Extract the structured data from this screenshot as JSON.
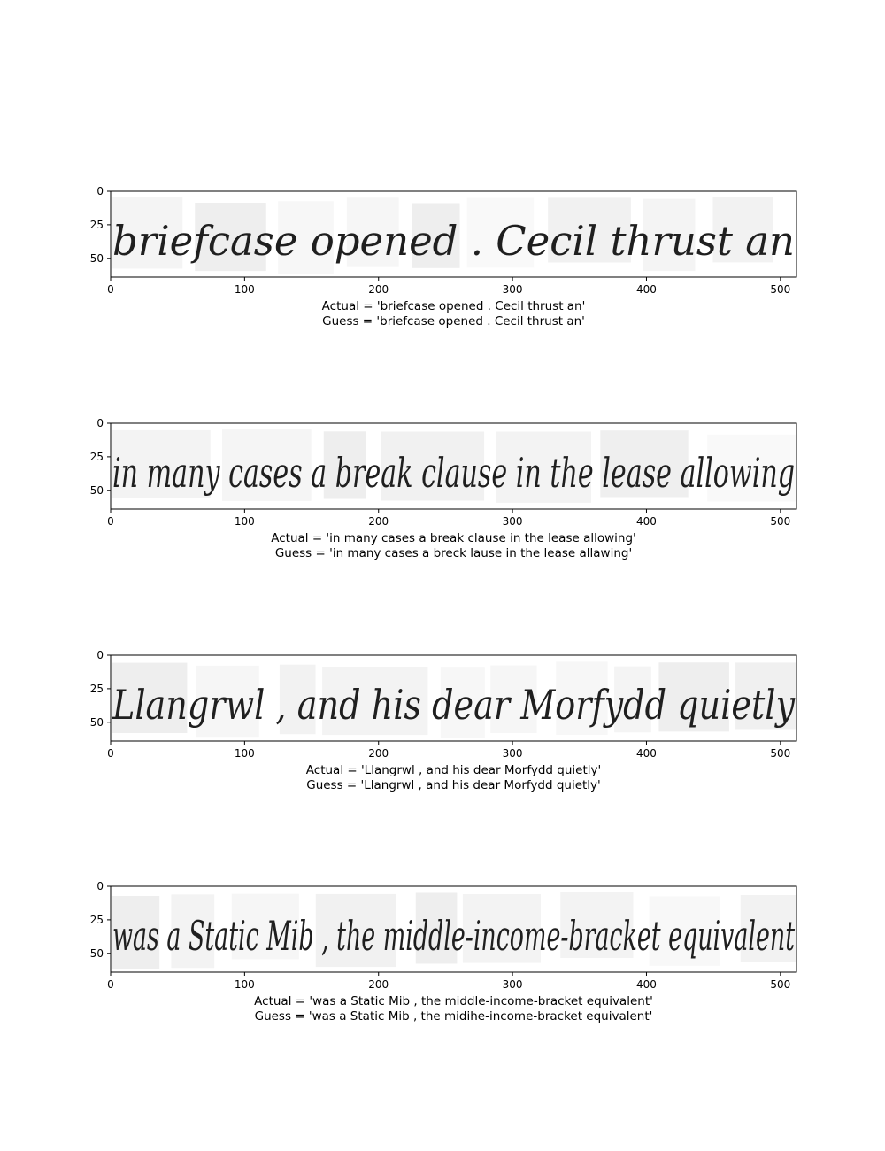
{
  "figure": {
    "panels": [
      {
        "handwriting": "briefcase opened . Cecil thrust an",
        "actual": "Actual = 'briefcase opened . Cecil thrust an'",
        "guess": "Guess = 'briefcase opened . Cecil thrust an'"
      },
      {
        "handwriting": "in many cases a break clause in the lease allowing",
        "actual": "Actual = 'in many cases a break clause in the lease allowing'",
        "guess": "Guess = 'in many cases a breck lause in the lease allawing'"
      },
      {
        "handwriting": "Llangrwl , and his dear Morfydd quietly",
        "actual": "Actual = 'Llangrwl , and his dear Morfydd quietly'",
        "guess": "Guess = 'Llangrwl , and his dear Morfydd quietly'"
      },
      {
        "handwriting": "was a Static Mib , the middle-income-bracket equivalent",
        "actual": "Actual = 'was a Static Mib , the middle-income-bracket equivalent'",
        "guess": "Guess = 'was a Static Mib , the midihe-income-bracket equivalent'"
      }
    ]
  },
  "chart_data": {
    "type": "image-grid",
    "xticks": [
      0,
      100,
      200,
      300,
      400,
      500
    ],
    "yticks": [
      0,
      25,
      50
    ],
    "xlim": [
      0,
      512
    ],
    "ylim": [
      64,
      0
    ],
    "colormap": "gray"
  }
}
